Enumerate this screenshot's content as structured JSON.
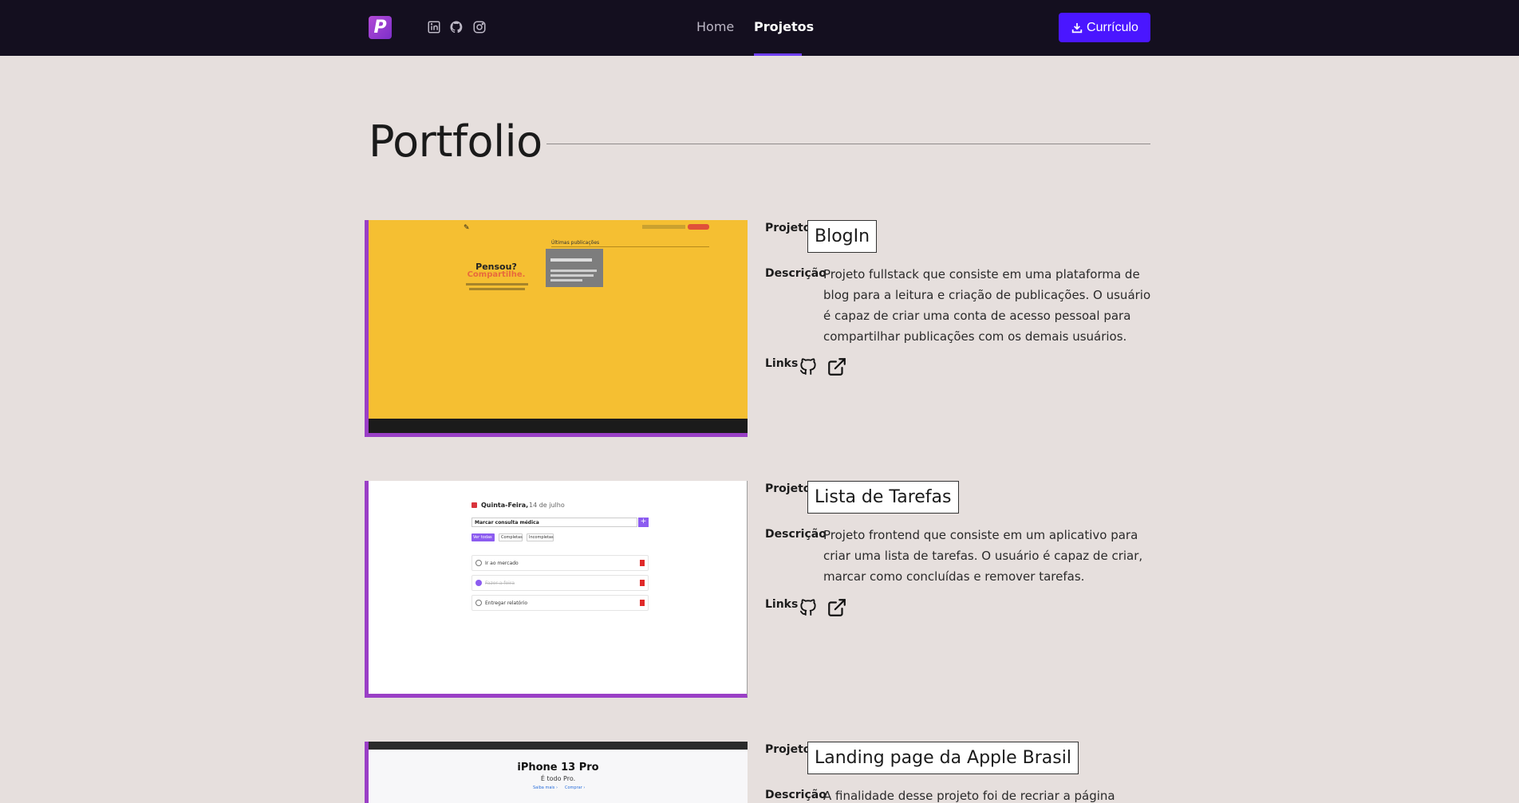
{
  "nav": {
    "logo_letter": "P",
    "social": [
      "linkedin-icon",
      "github-icon",
      "instagram-icon"
    ],
    "links": [
      {
        "label": "Home",
        "active": false
      },
      {
        "label": "Projetos",
        "active": true
      }
    ],
    "cv_button": "Currículo",
    "accent": "#6f3ff5",
    "button_color": "#4a16ff"
  },
  "page": {
    "title": "Portfolio"
  },
  "labels": {
    "project": "Projeto",
    "description": "Descrição",
    "links": "Links"
  },
  "projects": [
    {
      "name": "BlogIn",
      "description": "Projeto fullstack que consiste em uma plataforma de blog para a leitura e criação de publicações. O usuário é capaz de criar uma conta de acesso pessoal para compartilhar publicações com os demais usuários.",
      "links": [
        "github-icon",
        "external-link-icon"
      ],
      "preview": {
        "headline_1": "Pensou?",
        "headline_2": "Compartilhe.",
        "section": "Últimas publicações"
      }
    },
    {
      "name": "Lista de Tarefas",
      "description": "Projeto frontend que consiste em um aplicativo para criar uma lista de tarefas. O usuário é capaz de criar, marcar como concluídas e remover tarefas.",
      "links": [
        "github-icon",
        "external-link-icon"
      ],
      "preview": {
        "date_day": "Quinta-Feira,",
        "date_rest": "14 de julho",
        "input_value": "Marcar consulta médica",
        "filters": [
          "Ver todas",
          "Completas",
          "Incompletas"
        ],
        "tasks": [
          "Ir ao mercado",
          "Fazer a feira",
          "Entregar relatório"
        ]
      }
    },
    {
      "name": "Landing page da Apple Brasil",
      "description": "A finalidade desse projeto foi de recriar a página inicial",
      "preview": {
        "headline": "iPhone 13 Pro",
        "subhead": "É todo Pro.",
        "link_1": "Saiba mais ›",
        "link_2": "Comprar ›"
      }
    }
  ]
}
